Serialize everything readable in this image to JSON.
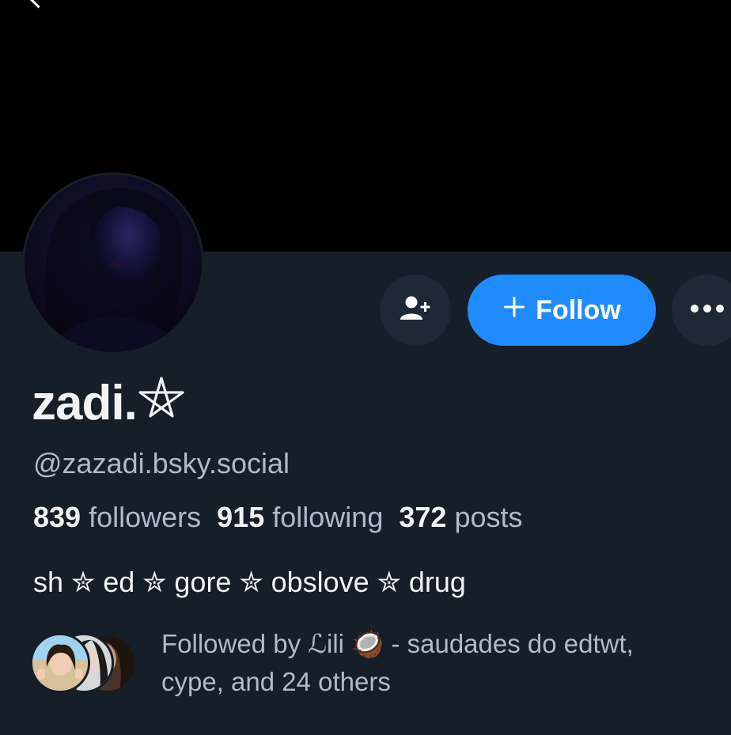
{
  "profile": {
    "display_name": "zadi.",
    "display_name_glyph": "pentagram",
    "handle": "@zazadi.bsky.social",
    "bio": "sh ✮ ed ✮ gore ✮ obslove ✮ drug"
  },
  "stats": {
    "followers_count": "839",
    "followers_label": "followers",
    "following_count": "915",
    "following_label": "following",
    "posts_count": "372",
    "posts_label": "posts"
  },
  "actions": {
    "add_user_icon": "person-plus-icon",
    "follow_label": "Follow",
    "follow_icon": "plus-icon",
    "more_icon": "ellipsis-icon"
  },
  "known_followers": {
    "line1_prefix": "Followed by ℒili ",
    "line1_emoji": "🥥",
    "line1_suffix": " - saudades do edtwt,",
    "line2": "cype, and 24 others"
  },
  "colors": {
    "background": "#161e27",
    "banner": "#000000",
    "accent": "#208bfe",
    "muted_text": "#aebbc9",
    "primary_text": "#f1f3f5",
    "icon_button_bg": "#1e2935"
  }
}
